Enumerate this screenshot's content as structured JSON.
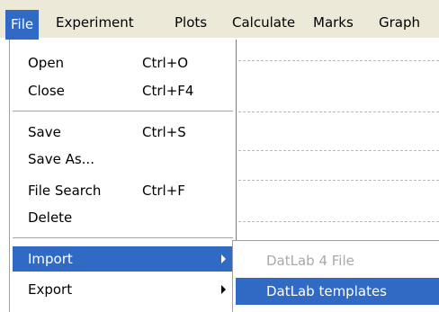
{
  "menubar": {
    "items": [
      "File",
      "Experiment",
      "Plots",
      "Calculate",
      "Marks",
      "Graph"
    ],
    "active": "File"
  },
  "file_menu": {
    "open": {
      "label": "Open",
      "shortcut": "Ctrl+O"
    },
    "close": {
      "label": "Close",
      "shortcut": "Ctrl+F4"
    },
    "save": {
      "label": "Save",
      "shortcut": "Ctrl+S"
    },
    "save_as": {
      "label": "Save As..."
    },
    "file_search": {
      "label": "File Search",
      "shortcut": "Ctrl+F"
    },
    "delete": {
      "label": "Delete"
    },
    "import": {
      "label": "Import",
      "has_submenu": true
    },
    "export": {
      "label": "Export",
      "has_submenu": true
    }
  },
  "import_submenu": {
    "items": [
      {
        "label": "DatLab 4 File",
        "enabled": false
      },
      {
        "label": "DatLab templates",
        "enabled": true,
        "highlighted": true
      }
    ]
  },
  "colors": {
    "highlight": "#316ac5",
    "menubar_bg": "#ece9d8",
    "disabled_text": "#a9a9a9"
  }
}
